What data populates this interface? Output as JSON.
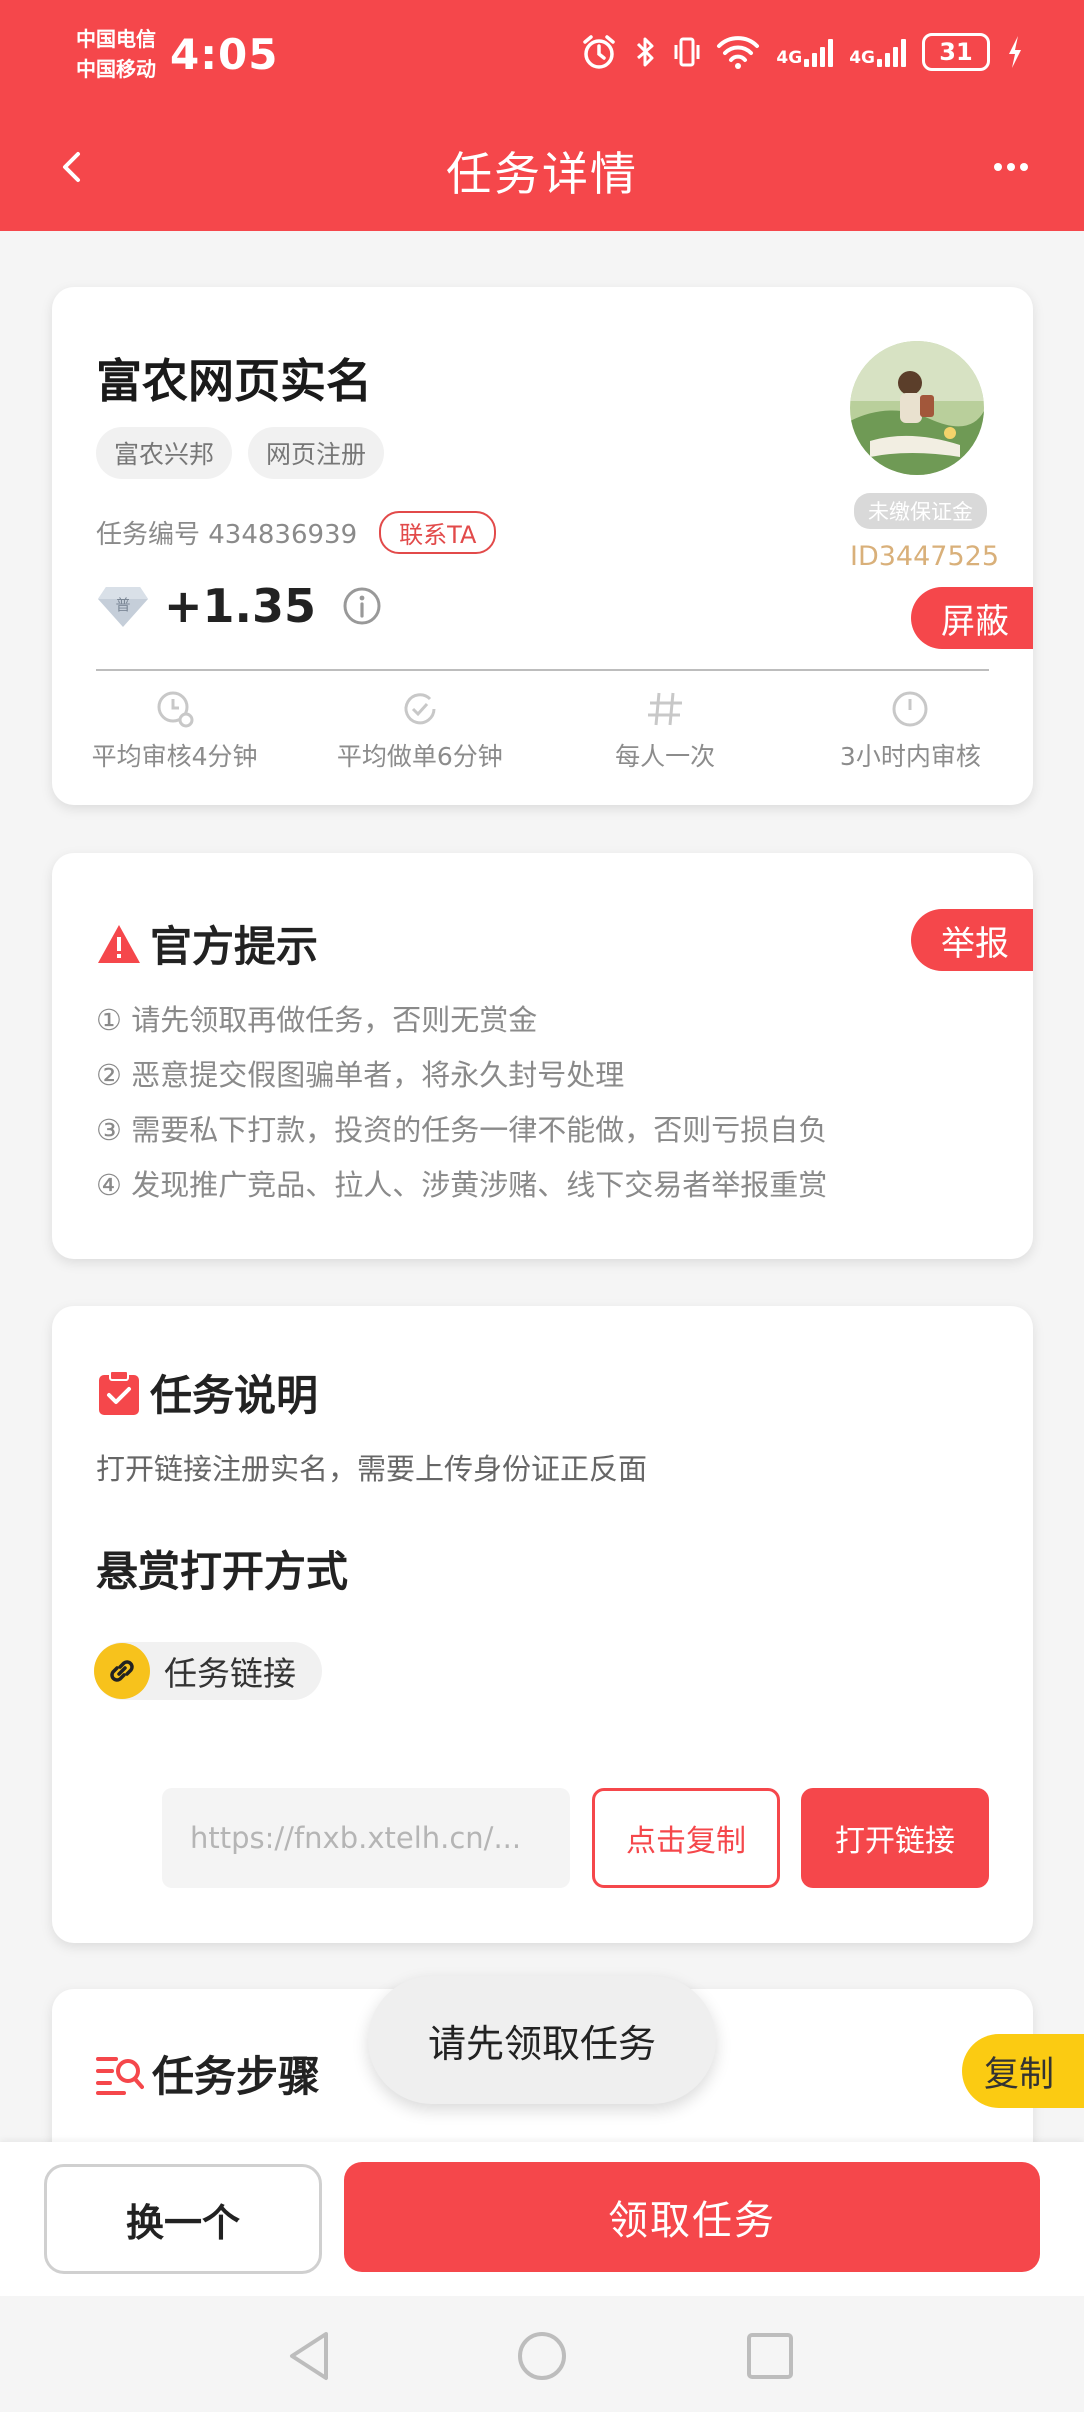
{
  "status_bar": {
    "carrier_1": "中国电信",
    "carrier_2": "中国移动",
    "time": "4:05",
    "network_1": "4G",
    "network_2": "4G",
    "battery": "31"
  },
  "nav": {
    "title": "任务详情"
  },
  "task": {
    "title": "富农网页实名",
    "tags": [
      "富农兴邦",
      "网页注册"
    ],
    "id_label": "任务编号 434836939",
    "contact_label": "联系TA",
    "reward": "+1.35",
    "reward_badge": "普",
    "deposit_badge": "未缴保证金",
    "user_id": "ID3447525",
    "block_label": "屏蔽",
    "stats": [
      {
        "label": "平均审核4分钟",
        "icon": "review-clock-icon"
      },
      {
        "label": "平均做单6分钟",
        "icon": "check-clock-icon"
      },
      {
        "label": "每人一次",
        "icon": "hash-icon"
      },
      {
        "label": "3小时内审核",
        "icon": "clock-icon"
      }
    ]
  },
  "notice": {
    "title": "官方提示",
    "report_label": "举报",
    "items": [
      "① 请先领取再做任务，否则无赏金",
      "② 恶意提交假图骗单者，将永久封号处理",
      "③ 需要私下打款，投资的任务一律不能做，否则亏损自负",
      "④ 发现推广竞品、拉人、涉黄涉赌、线下交易者举报重赏"
    ]
  },
  "description": {
    "title": "任务说明",
    "text": "打开链接注册实名，需要上传身份证正反面",
    "open_method_title": "悬赏打开方式",
    "link_chip_label": "任务链接",
    "url": "https://fnxb.xtelh.cn/...",
    "copy_label": "点击复制",
    "open_label": "打开链接"
  },
  "steps": {
    "title": "任务步骤",
    "copy_side_label": "复制"
  },
  "toast": "请先领取任务",
  "actions": {
    "switch_label": "换一个",
    "accept_label": "领取任务"
  },
  "colors": {
    "brand_red": "#f5474b",
    "accent_yellow": "#fbcb12",
    "uid_gold": "#d9b07a"
  }
}
